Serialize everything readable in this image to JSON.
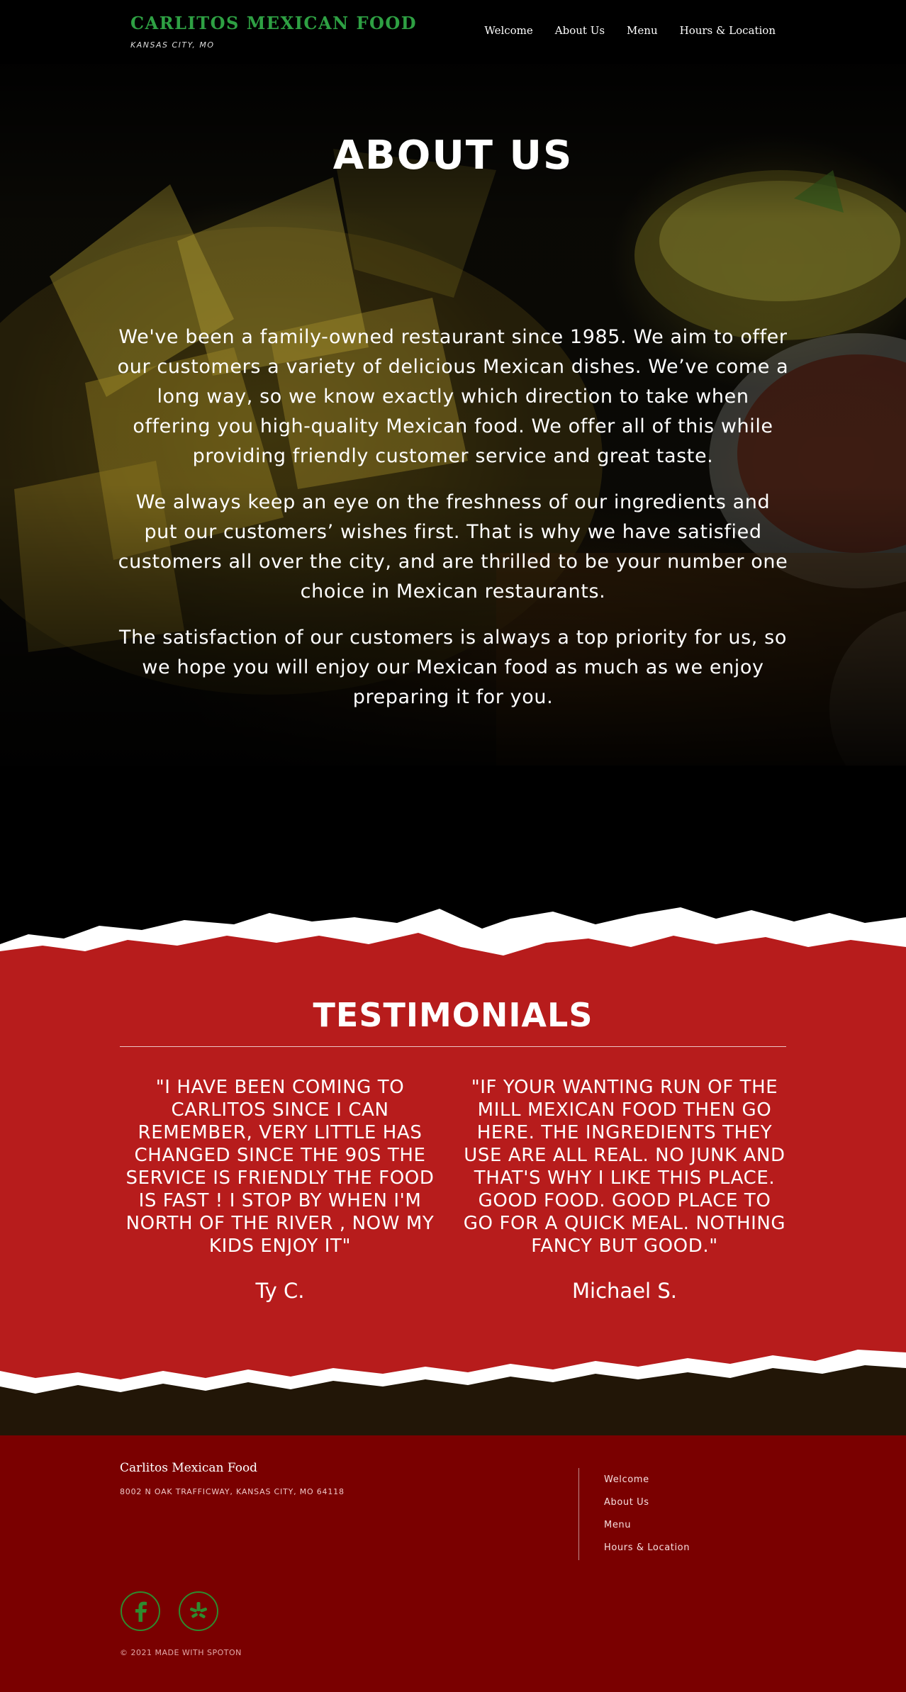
{
  "header": {
    "brand_name": "CARLITOS MEXICAN FOOD",
    "location": "KANSAS CITY, MO",
    "nav": [
      "Welcome",
      "About Us",
      "Menu",
      "Hours & Location"
    ]
  },
  "hero": {
    "title": "ABOUT US",
    "paragraphs": [
      "We've been a family-owned restaurant since 1985. We aim to offer our customers a variety of delicious Mexican dishes. We’ve come a long way, so we know exactly which direction to take when offering you high-quality Mexican food. We offer all of this while providing friendly customer service and great taste.",
      "We always keep an eye on the freshness of our ingredients and put our customers’ wishes first. That is why we have satisfied customers all over the city, and are thrilled to be your number one choice in Mexican restaurants.",
      "The satisfaction of our customers is always a top priority for us, so we hope you will enjoy our Mexican food as much as we enjoy preparing it for you."
    ]
  },
  "testimonials": {
    "title": "TESTIMONIALS",
    "items": [
      {
        "quote": "\"I HAVE BEEN COMING TO CARLITOS SINCE I CAN REMEMBER, VERY LITTLE HAS CHANGED SINCE THE 90S THE SERVICE IS FRIENDLY THE FOOD IS FAST ! I STOP BY WHEN I'M NORTH OF THE RIVER , NOW MY KIDS ENJOY IT\"",
        "author": "Ty C."
      },
      {
        "quote": "\"IF YOUR WANTING RUN OF THE MILL MEXICAN FOOD THEN GO HERE. THE INGREDIENTS THEY USE ARE ALL REAL. NO JUNK AND THAT'S WHY I LIKE THIS PLACE. GOOD FOOD. GOOD PLACE TO GO FOR A QUICK MEAL. NOTHING FANCY BUT GOOD.\"",
        "author": "Michael S."
      }
    ]
  },
  "footer": {
    "name": "Carlitos Mexican Food",
    "address": "8002 N OAK TRAFFICWAY, KANSAS CITY, MO 64118",
    "links": [
      "Welcome",
      "About Us",
      "Menu",
      "Hours & Location"
    ],
    "social": [
      {
        "icon": "facebook-icon"
      },
      {
        "icon": "yelp-icon"
      }
    ],
    "copyright": "© 2021 MADE WITH SPOTON"
  },
  "colors": {
    "brand_green": "#2ea043",
    "testimonial_red": "#b71c1c",
    "footer_red": "#7a0000",
    "social_green": "#2e8b2e"
  }
}
